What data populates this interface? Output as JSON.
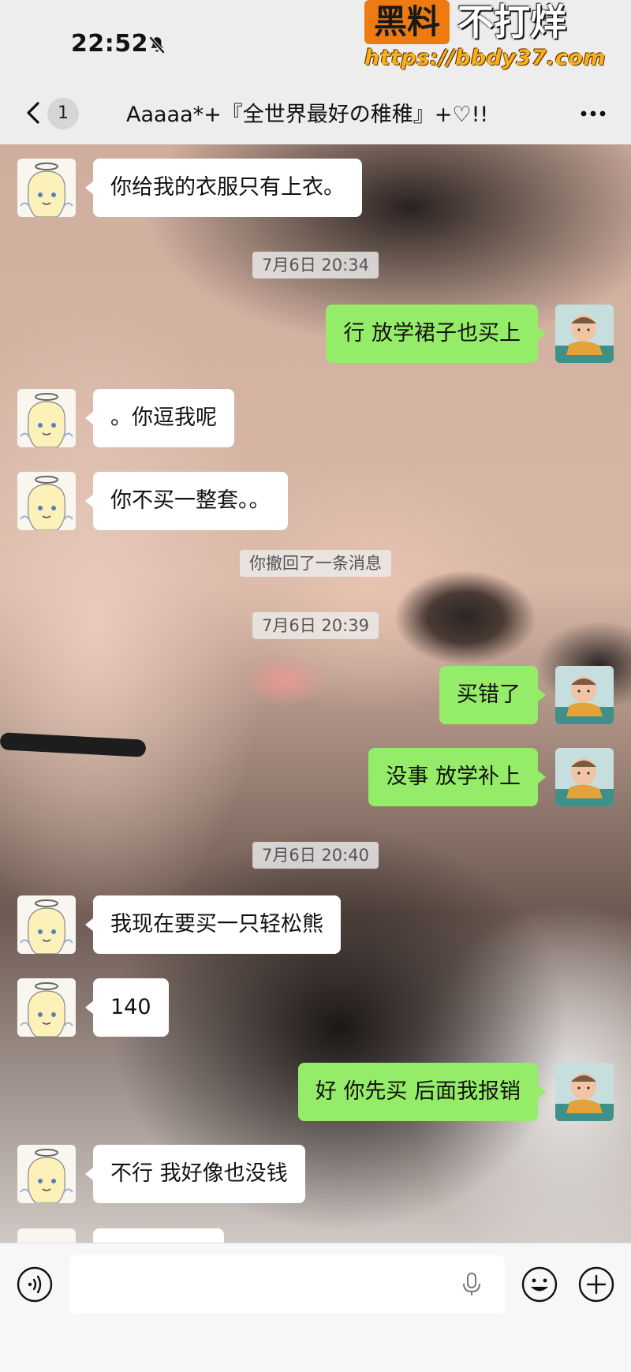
{
  "status_bar": {
    "time": "22:52",
    "icons": [
      "bell-slash-icon"
    ]
  },
  "watermark": {
    "badge": "黑料",
    "title": "不打烊",
    "url": "https://bbdy37.com"
  },
  "header": {
    "back_icon": "chevron-left-icon",
    "unread_count": "1",
    "title": "Aaaaa*+『全世界最好の稚稚』+♡!!",
    "more_icon": "ellipsis-icon"
  },
  "messages": [
    {
      "type": "text",
      "side": "left",
      "text": "你给我的衣服只有上衣。"
    },
    {
      "type": "time",
      "text": "7月6日 20:34"
    },
    {
      "type": "text",
      "side": "right",
      "text": "行 放学裙子也买上"
    },
    {
      "type": "text",
      "side": "left",
      "text": "。你逗我呢"
    },
    {
      "type": "text",
      "side": "left",
      "text": "你不买一整套。。"
    },
    {
      "type": "system",
      "text": "你撤回了一条消息"
    },
    {
      "type": "time",
      "text": "7月6日 20:39"
    },
    {
      "type": "text",
      "side": "right",
      "text": "买错了"
    },
    {
      "type": "text",
      "side": "right",
      "text": "没事 放学补上"
    },
    {
      "type": "time",
      "text": "7月6日 20:40"
    },
    {
      "type": "text",
      "side": "left",
      "text": "我现在要买一只轻松熊"
    },
    {
      "type": "text",
      "side": "left",
      "text": "140"
    },
    {
      "type": "text",
      "side": "right",
      "text": "好 你先买 后面我报销"
    },
    {
      "type": "text",
      "side": "left",
      "text": "不行 我好像也没钱"
    }
  ],
  "input_bar": {
    "voice_icon": "voice-icon",
    "placeholder": "",
    "mic_icon": "mic-icon",
    "emoji_icon": "emoji-icon",
    "plus_icon": "plus-icon"
  },
  "colors": {
    "sent_bubble": "#95ec69",
    "received_bubble": "#ffffff",
    "background": "#ededed"
  }
}
